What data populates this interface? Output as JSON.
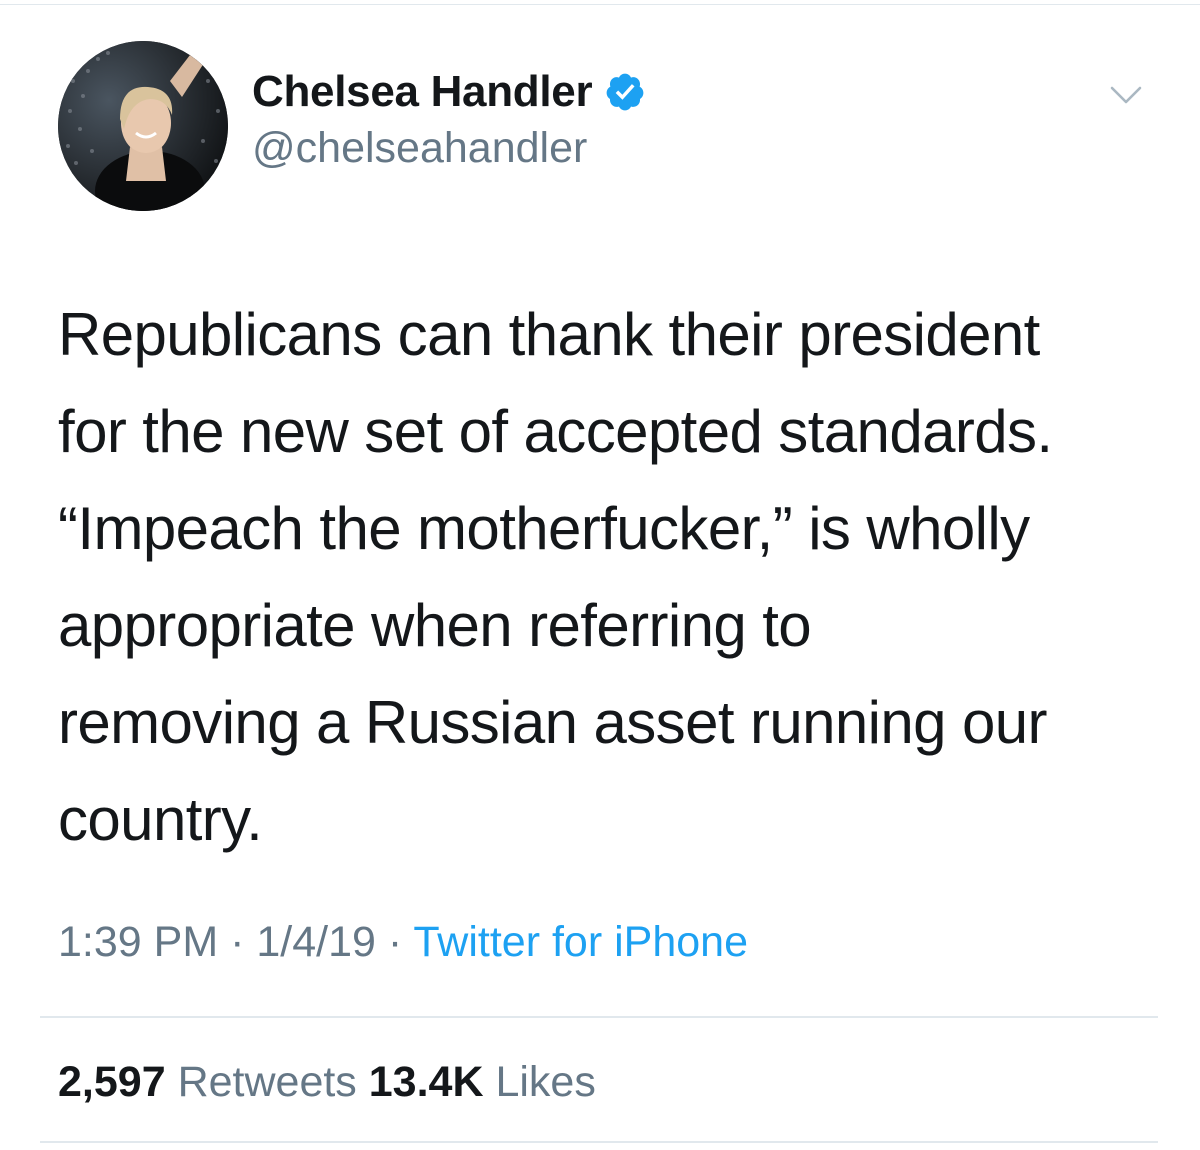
{
  "user": {
    "display_name": "Chelsea Handler",
    "handle": "@chelseahandler",
    "verified": true,
    "avatar_icon": "profile-photo"
  },
  "tweet": {
    "lines": [
      "Republicans can thank their president",
      "for the new set of accepted standards.",
      "“Impeach the motherfucker,” is wholly",
      "appropriate when referring to",
      "removing a Russian asset running our",
      "country."
    ]
  },
  "meta": {
    "time": "1:39 PM",
    "separator": "·",
    "date": "1/4/19",
    "source": "Twitter for iPhone"
  },
  "stats": {
    "retweets_count": "2,597",
    "retweets_label": "Retweets",
    "likes_count": "13.4K",
    "likes_label": "Likes"
  },
  "colors": {
    "text": "#14171a",
    "secondary": "#657786",
    "link": "#1da1f2",
    "verified": "#1da1f2",
    "divider": "#e1e8ed"
  },
  "icons": {
    "verified": "verified-badge-icon",
    "menu": "chevron-down-icon"
  }
}
